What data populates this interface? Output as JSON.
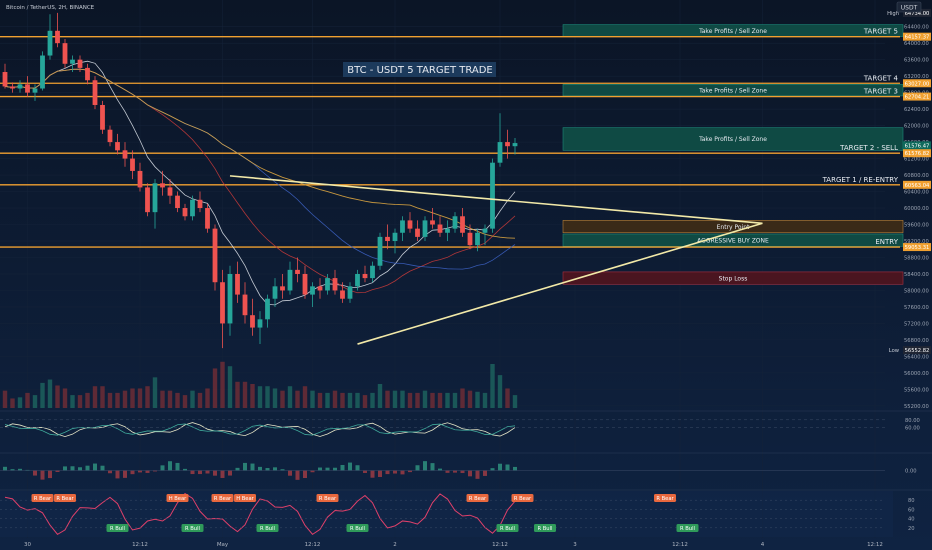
{
  "header": {
    "symbol_line": "Bitcoin / TetherUS, 2H, BINANCE",
    "currency": "USDT"
  },
  "chart_data": {
    "type": "candlestick",
    "title": "BTC - USDT  5 TARGET  TRADE",
    "price_axis": {
      "ylim": [
        55100,
        64950
      ],
      "ticks": [
        64400,
        64000,
        63600,
        63200,
        62800,
        62400,
        62000,
        61600,
        61200,
        60800,
        60400,
        60000,
        59600,
        59200,
        58800,
        58400,
        58000,
        57600,
        57200,
        56800,
        56400,
        56000,
        55600,
        55200
      ],
      "tick_labels": [
        "64400.00",
        "64000.00",
        "63600.00",
        "63200.00",
        "62800.00",
        "62400.00",
        "62000.00",
        "61600.00",
        "61200.00",
        "60800.00",
        "60400.00",
        "60000.00",
        "59600.00",
        "59200.00",
        "58800.00",
        "58400.00",
        "58000.00",
        "57600.00",
        "57200.00",
        "56800.00",
        "56400.00",
        "56000.00",
        "55600.00",
        "55200.00"
      ],
      "badges": [
        {
          "label": "High",
          "value": "64734.00",
          "y": 64734,
          "color": "#1f2533"
        },
        {
          "value": "64157.37",
          "y": 64157,
          "color": "#f0a030"
        },
        {
          "value": "63027.00",
          "y": 63027,
          "color": "#f0a030"
        },
        {
          "value": "62704.21",
          "y": 62704,
          "color": "#f0a030"
        },
        {
          "value": "61576.47",
          "y": 61520,
          "color": "#0f6a5c"
        },
        {
          "value": "61576.82",
          "y": 61330,
          "color": "#f0a030"
        },
        {
          "value": "60563.04",
          "y": 60563,
          "color": "#f0a030"
        },
        {
          "value": "59053.31",
          "y": 59053,
          "color": "#f0a030"
        },
        {
          "label": "Low",
          "value": "56552.82",
          "y": 56553,
          "color": "#1f2533"
        }
      ]
    },
    "x_axis": {
      "tick_labels": [
        "30",
        "12:12",
        "May",
        "12:12",
        "2",
        "12:12",
        "3",
        "12:12",
        "4",
        "12:12",
        "5",
        "12:12",
        "6",
        "12:12"
      ],
      "tick_index": [
        3,
        18,
        29,
        41,
        52,
        66,
        76,
        90,
        101,
        116,
        127,
        141,
        152,
        166
      ]
    },
    "candles": [
      [
        63300,
        63500,
        62900,
        62950
      ],
      [
        62950,
        63050,
        62800,
        62900
      ],
      [
        62900,
        63100,
        62800,
        63000
      ],
      [
        63000,
        63200,
        62700,
        62800
      ],
      [
        62800,
        63000,
        62600,
        62900
      ],
      [
        62900,
        63800,
        62850,
        63700
      ],
      [
        63700,
        64700,
        63600,
        64300
      ],
      [
        64300,
        64734,
        63900,
        64000
      ],
      [
        64000,
        64100,
        63400,
        63500
      ],
      [
        63500,
        63700,
        63300,
        63600
      ],
      [
        63600,
        63700,
        63300,
        63400
      ],
      [
        63400,
        63500,
        63000,
        63100
      ],
      [
        63100,
        63200,
        62400,
        62500
      ],
      [
        62500,
        62600,
        61800,
        61900
      ],
      [
        61900,
        62000,
        61500,
        61600
      ],
      [
        61600,
        61800,
        61300,
        61400
      ],
      [
        61400,
        61600,
        61000,
        61200
      ],
      [
        61200,
        61400,
        60700,
        60900
      ],
      [
        60900,
        61100,
        60400,
        60500
      ],
      [
        60500,
        60600,
        59800,
        59900
      ],
      [
        59900,
        60700,
        59500,
        60600
      ],
      [
        60600,
        60900,
        60300,
        60500
      ],
      [
        60500,
        60700,
        60100,
        60300
      ],
      [
        60300,
        60400,
        59900,
        60000
      ],
      [
        60000,
        60100,
        59700,
        59800
      ],
      [
        59800,
        60300,
        59700,
        60200
      ],
      [
        60200,
        60400,
        59900,
        60000
      ],
      [
        60000,
        60100,
        59400,
        59500
      ],
      [
        59500,
        59600,
        58000,
        58200
      ],
      [
        58200,
        58500,
        56600,
        57200
      ],
      [
        57200,
        58600,
        56900,
        58400
      ],
      [
        58400,
        58700,
        57700,
        57900
      ],
      [
        57900,
        58200,
        57200,
        57400
      ],
      [
        57400,
        57800,
        56900,
        57100
      ],
      [
        57100,
        57500,
        56700,
        57300
      ],
      [
        57300,
        57900,
        57100,
        57800
      ],
      [
        57800,
        58300,
        57600,
        58100
      ],
      [
        58100,
        58400,
        57800,
        58000
      ],
      [
        58000,
        58700,
        57900,
        58500
      ],
      [
        58500,
        58800,
        58200,
        58400
      ],
      [
        58400,
        58600,
        57800,
        57900
      ],
      [
        57900,
        58200,
        57600,
        58100
      ],
      [
        58100,
        58300,
        57800,
        58000
      ],
      [
        58000,
        58400,
        57900,
        58300
      ],
      [
        58300,
        58500,
        57900,
        58000
      ],
      [
        58000,
        58200,
        57700,
        57800
      ],
      [
        57800,
        58200,
        57700,
        58100
      ],
      [
        58100,
        58500,
        58000,
        58400
      ],
      [
        58400,
        58600,
        58200,
        58300
      ],
      [
        58300,
        58700,
        58200,
        58600
      ],
      [
        58600,
        59400,
        58500,
        59300
      ],
      [
        59300,
        59600,
        59000,
        59200
      ],
      [
        59200,
        59500,
        58900,
        59400
      ],
      [
        59400,
        59800,
        59200,
        59700
      ],
      [
        59700,
        59900,
        59400,
        59500
      ],
      [
        59500,
        59700,
        59200,
        59300
      ],
      [
        59300,
        59800,
        59200,
        59700
      ],
      [
        59700,
        60000,
        59500,
        59600
      ],
      [
        59600,
        59800,
        59300,
        59400
      ],
      [
        59400,
        59700,
        59200,
        59500
      ],
      [
        59500,
        59900,
        59400,
        59800
      ],
      [
        59800,
        60000,
        59300,
        59400
      ],
      [
        59400,
        59600,
        59000,
        59100
      ],
      [
        59100,
        59500,
        58950,
        59400
      ],
      [
        59400,
        59600,
        59100,
        59500
      ],
      [
        59500,
        61200,
        59400,
        61100
      ],
      [
        61100,
        62300,
        61000,
        61600
      ],
      [
        61600,
        61900,
        61200,
        61500
      ],
      [
        61500,
        61700,
        61300,
        61576
      ]
    ],
    "levels": [
      {
        "label": "TARGET 5",
        "price": 64157
      },
      {
        "label": "TARGET 4",
        "price": 63027
      },
      {
        "label": "TARGET 3",
        "price": 62704
      },
      {
        "label": "TARGET 2 - SELL",
        "price": 61330
      },
      {
        "label": "TARGET 1 / RE-ENTRY",
        "price": 60563
      },
      {
        "label": "ENTRY",
        "price": 59053
      }
    ],
    "zones": [
      {
        "label": "Take Profits / Sell Zone",
        "top": 64450,
        "bottom": 64160,
        "fill": "#0f4a44",
        "stroke": "#1d8a78"
      },
      {
        "label": "Take Profits / Sell Zone",
        "top": 63000,
        "bottom": 62720,
        "fill": "#0f4a44",
        "stroke": "#1d8a78"
      },
      {
        "label": "Take Profits / Sell Zone",
        "top": 61950,
        "bottom": 61400,
        "fill": "#0f4a44",
        "stroke": "#1d8a78"
      },
      {
        "label": "Entry Point",
        "top": 59700,
        "bottom": 59400,
        "fill": "#3a2a18",
        "stroke": "#b8823a"
      },
      {
        "label": "AGGRESSIVE BUY ZONE",
        "top": 59370,
        "bottom": 59070,
        "fill": "#0f4a44",
        "stroke": "#1d8a78"
      },
      {
        "label": "Stop Loss",
        "top": 58450,
        "bottom": 58150,
        "fill": "#4a1520",
        "stroke": "#a83040"
      }
    ],
    "triangle": {
      "upper": [
        [
          30,
          60780
        ],
        [
          101,
          59630
        ]
      ],
      "lower": [
        [
          47,
          56700
        ],
        [
          101,
          59630
        ]
      ]
    },
    "indicator_1": {
      "ticks": [
        80,
        60
      ],
      "tick_labels": [
        "80.00",
        "60.00"
      ]
    },
    "indicator_2": {
      "ticks": [
        0
      ],
      "tick_labels": [
        "0.00"
      ]
    },
    "indicator_3": {
      "ticks": [
        80,
        60,
        40,
        20
      ],
      "tick_labels": [
        "80",
        "60",
        "40",
        "20"
      ],
      "signals": [
        {
          "label": "R Bear",
          "type": "bear",
          "index": 5
        },
        {
          "label": "R Bear",
          "type": "bear",
          "index": 8
        },
        {
          "label": "R Bull",
          "type": "bull",
          "index": 15
        },
        {
          "label": "H Bear",
          "type": "bear",
          "index": 23
        },
        {
          "label": "R Bull",
          "type": "bull",
          "index": 25
        },
        {
          "label": "R Bear",
          "type": "bear",
          "index": 29
        },
        {
          "label": "H Bear",
          "type": "bear",
          "index": 32
        },
        {
          "label": "R Bull",
          "type": "bull",
          "index": 35
        },
        {
          "label": "R Bear",
          "type": "bear",
          "index": 43
        },
        {
          "label": "R Bull",
          "type": "bull",
          "index": 47
        },
        {
          "label": "R Bear",
          "type": "bear",
          "index": 63
        },
        {
          "label": "R Bear",
          "type": "bear",
          "index": 69
        },
        {
          "label": "R Bull",
          "type": "bull",
          "index": 67
        },
        {
          "label": "R Bull",
          "type": "bull",
          "index": 72
        },
        {
          "label": "R Bear",
          "type": "bear",
          "index": 88
        },
        {
          "label": "R Bull",
          "type": "bull",
          "index": 91
        }
      ]
    }
  }
}
